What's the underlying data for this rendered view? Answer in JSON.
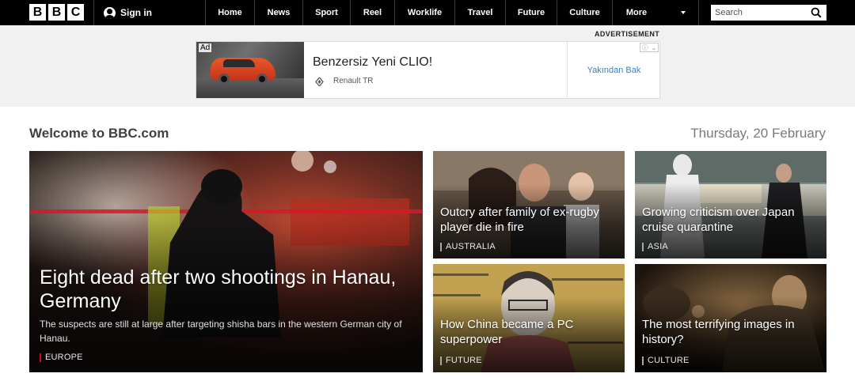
{
  "brand": {
    "letters": [
      "B",
      "B",
      "C"
    ]
  },
  "nav": {
    "signin_label": "Sign in",
    "items": [
      "Home",
      "News",
      "Sport",
      "Reel",
      "Worklife",
      "Travel",
      "Future",
      "Culture",
      "More"
    ],
    "search_placeholder": "Search"
  },
  "ad": {
    "label": "ADVERTISEMENT",
    "tag": "Ad",
    "headline": "Benzersiz Yeni CLIO!",
    "brand": "Renault TR",
    "cta": "Yakından Bak"
  },
  "page": {
    "welcome": "Welcome to BBC.com",
    "date": "Thursday, 20 February"
  },
  "stories": [
    {
      "title": "Eight dead after two shootings in Hanau, Germany",
      "summary": "The suspects are still at large after targeting shisha bars in the western German city of Hanau.",
      "section": "EUROPE",
      "section_color": "#e2001a"
    },
    {
      "title": "Outcry after family of ex-rugby player die in fire",
      "section": "AUSTRALIA",
      "section_color": "#a8a8a8"
    },
    {
      "title": "Growing criticism over Japan cruise quarantine",
      "section": "ASIA",
      "section_color": "#a8a8a8"
    },
    {
      "title": "How China became a PC superpower",
      "section": "FUTURE",
      "section_color": "#a8a8a8"
    },
    {
      "title": "The most terrifying images in history?",
      "section": "CULTURE",
      "section_color": "#a8a8a8"
    }
  ]
}
